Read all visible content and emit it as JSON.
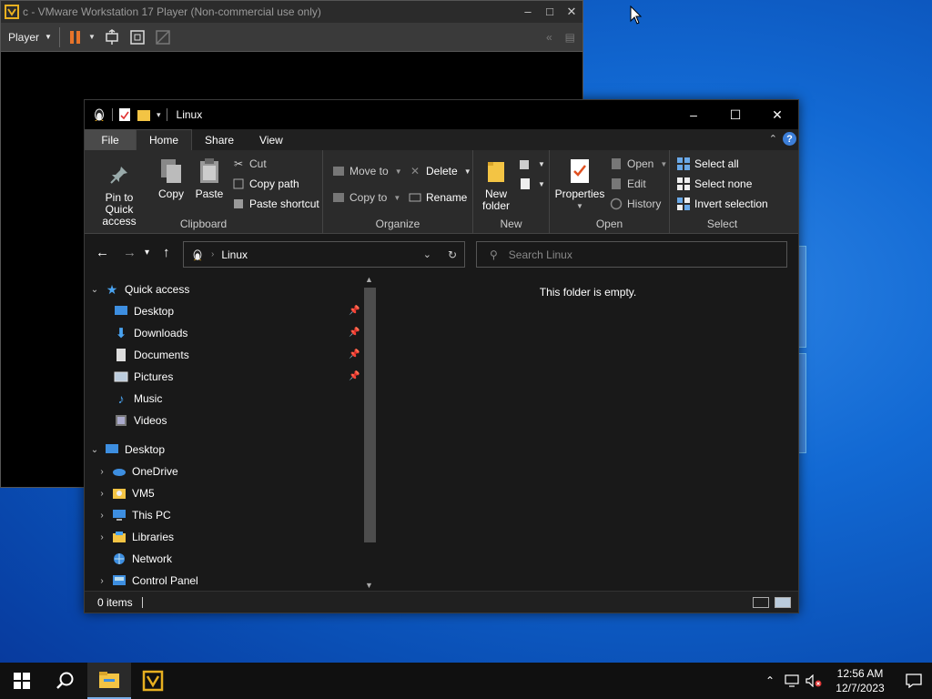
{
  "vmware": {
    "title": "c - VMware Workstation 17 Player (Non-commercial use only)",
    "player_label": "Player"
  },
  "explorer": {
    "title": "Linux",
    "tabs": [
      {
        "label": "File"
      },
      {
        "label": "Home"
      },
      {
        "label": "Share"
      },
      {
        "label": "View"
      }
    ],
    "ribbon": {
      "clipboard": {
        "pin": "Pin to Quick access",
        "copy": "Copy",
        "paste": "Paste",
        "cut": "Cut",
        "copy_path": "Copy path",
        "paste_shortcut": "Paste shortcut",
        "label": "Clipboard"
      },
      "organize": {
        "move_to": "Move to",
        "copy_to": "Copy to",
        "delete": "Delete",
        "rename": "Rename",
        "label": "Organize"
      },
      "new": {
        "new_folder": "New folder",
        "label": "New"
      },
      "open": {
        "properties": "Properties",
        "open": "Open",
        "edit": "Edit",
        "history": "History",
        "label": "Open"
      },
      "select": {
        "select_all": "Select all",
        "select_none": "Select none",
        "invert": "Invert selection",
        "label": "Select"
      }
    },
    "address": {
      "crumb": "Linux"
    },
    "search": {
      "placeholder": "Search Linux"
    },
    "tree": {
      "quick_access": "Quick access",
      "qa_items": [
        "Desktop",
        "Downloads",
        "Documents",
        "Pictures",
        "Music",
        "Videos"
      ],
      "desktop": "Desktop",
      "desktop_items": [
        "OneDrive",
        "VM5",
        "This PC",
        "Libraries",
        "Network",
        "Control Panel"
      ]
    },
    "empty_message": "This folder is empty.",
    "status": {
      "items": "0 items"
    }
  },
  "taskbar": {
    "time": "12:56 AM",
    "date": "12/7/2023"
  },
  "colors": {
    "accent": "#3c7ed8",
    "pause": "#e8742a",
    "folder": "#f3c444"
  }
}
